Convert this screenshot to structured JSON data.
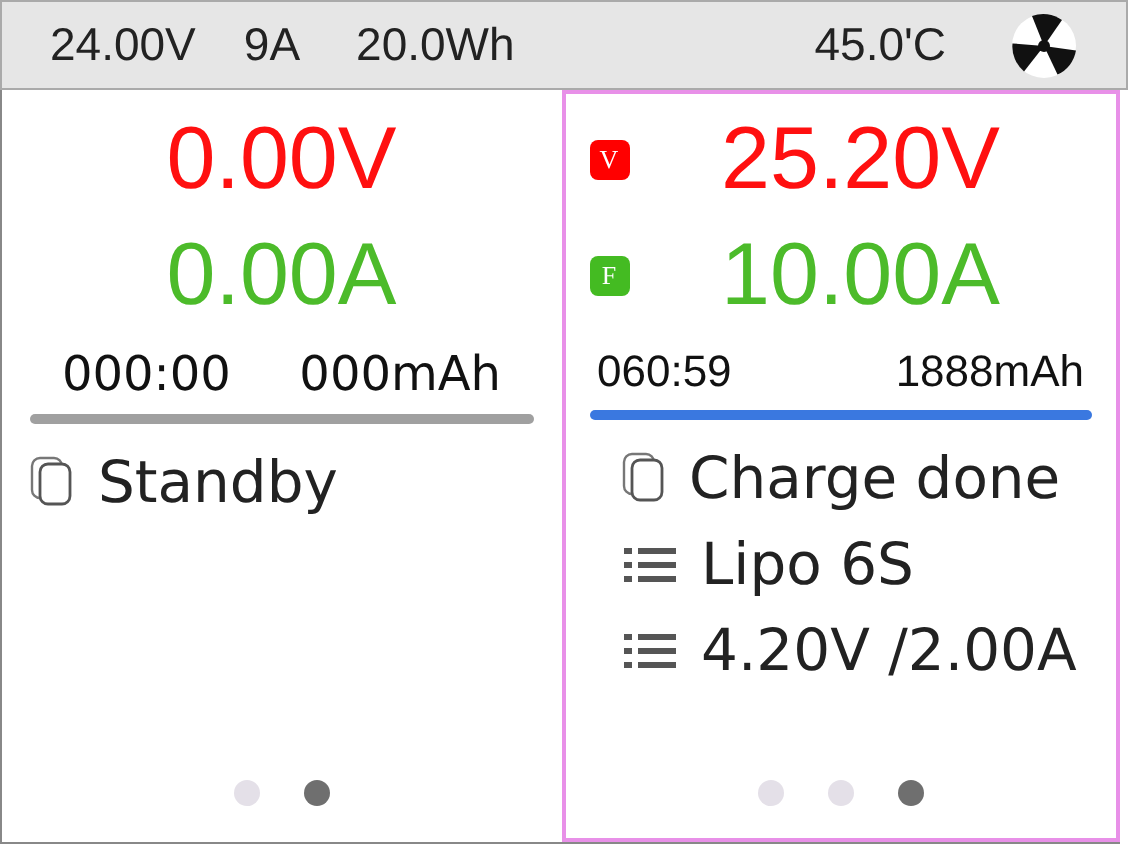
{
  "status_bar": {
    "voltage": "24.00V",
    "current": "9A",
    "energy": "20.0Wh",
    "temperature": "45.0'C"
  },
  "channels": [
    {
      "selected": false,
      "voltage": "0.00V",
      "current": "0.00A",
      "time": "000:00",
      "capacity": "000mAh",
      "bar": {
        "color": "#a0a0a0"
      },
      "lines": [
        {
          "kind": "status",
          "text": "Standby"
        }
      ],
      "pages": [
        {
          "selected": false
        },
        {
          "selected": true
        }
      ]
    },
    {
      "selected": true,
      "badges": [
        {
          "text": "V",
          "color": "#ff0000"
        },
        {
          "text": "F",
          "color": "#44bb22"
        }
      ],
      "voltage": "25.20V",
      "current": "10.00A",
      "time": "060:59",
      "capacity": "1888mAh",
      "bar": {
        "color": "#3a78e0"
      },
      "lines": [
        {
          "kind": "status",
          "text": "Charge done"
        },
        {
          "kind": "info",
          "text": "Lipo 6S"
        },
        {
          "kind": "info",
          "text": "4.20V /2.00A"
        }
      ],
      "pages": [
        {
          "selected": false
        },
        {
          "selected": false
        },
        {
          "selected": true
        }
      ]
    }
  ]
}
